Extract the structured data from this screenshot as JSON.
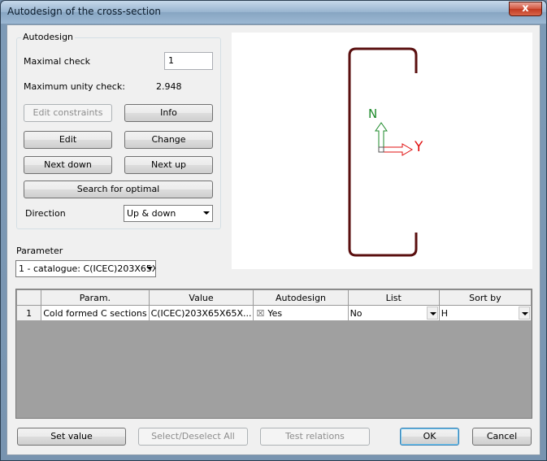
{
  "window": {
    "title": "Autodesign of the cross-section",
    "close_glyph": "x"
  },
  "autodesign": {
    "group_title": "Autodesign",
    "maximal_check_label": "Maximal check",
    "maximal_check_value": "1",
    "max_unity_label": "Maximum unity check:",
    "max_unity_value": "2.948",
    "edit_constraints": "Edit constraints",
    "info": "Info",
    "edit": "Edit",
    "change": "Change",
    "next_down": "Next down",
    "next_up": "Next up",
    "search_optimal": "Search for optimal",
    "direction_label": "Direction",
    "direction_value": "Up & down"
  },
  "parameter": {
    "label": "Parameter",
    "value": "1 - catalogue: C(ICEC)203X65X"
  },
  "preview": {
    "axis_n": "N",
    "axis_y": "Y"
  },
  "grid": {
    "headers": [
      "",
      "Param.",
      "Value",
      "Autodesign",
      "List",
      "Sort by"
    ],
    "rows": [
      {
        "index": "1",
        "param": "Cold formed C sections",
        "value": "C(ICEC)203X65X65X...",
        "autodesign_check": "☒",
        "autodesign": "Yes",
        "list": "No",
        "sort_by": "H"
      }
    ]
  },
  "buttons": {
    "set_value": "Set value",
    "select_deselect": "Select/Deselect All",
    "test_relations": "Test relations",
    "ok": "OK",
    "cancel": "Cancel"
  },
  "colors": {
    "section": "#5a0f0f",
    "n_axis": "#1d8a2a",
    "y_axis": "#e01010"
  }
}
